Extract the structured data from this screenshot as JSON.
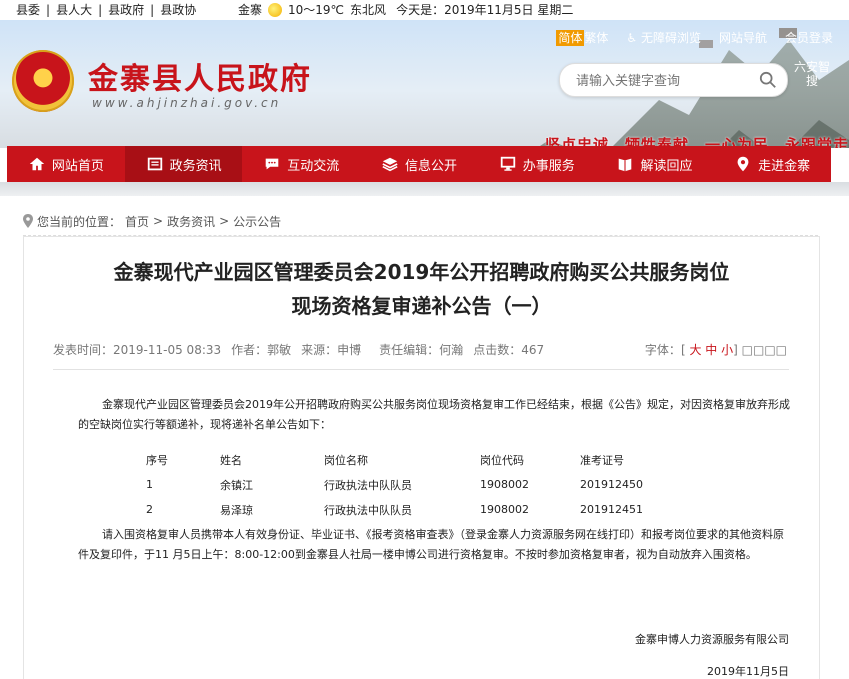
{
  "topbar": {
    "nav": [
      "县委",
      "县人大",
      "县政府",
      "县政协"
    ],
    "weather": {
      "city": "金寨",
      "temp": "10～19℃",
      "wind": "东北风"
    },
    "today": "今天是：2019年11月5日 星期二"
  },
  "header": {
    "site_name": "金寨县人民政府",
    "site_url": "www.ahjinzhai.gov.cn",
    "lang_simplified": "简体",
    "lang_traditional": "繁体",
    "accessible": "无障碍浏览",
    "site_nav": "网站导航",
    "login": "会员登录",
    "search_placeholder": "请输入关键字查询",
    "brand_right": "六安智搜",
    "slogan": "坚贞忠诚　牺牲奉献　一心为民　永跟党走",
    "colors": {
      "accent": "#c8141b",
      "accent_dark": "#a80f15",
      "highlight": "#f19a00"
    }
  },
  "navbar": [
    {
      "label": "网站首页",
      "icon": "home-icon"
    },
    {
      "label": "政务资讯",
      "icon": "newspaper-icon"
    },
    {
      "label": "互动交流",
      "icon": "chat-icon"
    },
    {
      "label": "信息公开",
      "icon": "layers-icon"
    },
    {
      "label": "办事服务",
      "icon": "monitor-icon"
    },
    {
      "label": "解读回应",
      "icon": "book-icon"
    },
    {
      "label": "走进金寨",
      "icon": "location-icon"
    }
  ],
  "breadcrumb": {
    "prefix": "您当前的位置：",
    "items": [
      "首页",
      "政务资讯",
      "公示公告"
    ],
    "sep": " > "
  },
  "article": {
    "title_line1": "金寨现代产业园区管理委员会2019年公开招聘政府购买公共服务岗位",
    "title_line2": "现场资格复审递补公告（一）",
    "meta": {
      "published": "发表时间：2019-11-05 08:33",
      "author": "作者：郭敏",
      "source": "来源：申博",
      "editor": "责任编辑：何瀚",
      "clicks": "点击数：467"
    },
    "font_label": "字体：",
    "font_sizes": [
      "大",
      "中",
      "小"
    ],
    "font_boxes": "□□□□",
    "para1": "金寨现代产业园区管理委员会2019年公开招聘政府购买公共服务岗位现场资格复审工作已经结束，根据《公告》规定，对因资格复审放弃形成的空缺岗位实行等额递补，现将递补名单公告如下：",
    "table": {
      "headers": [
        "序号",
        "姓名",
        "岗位名称",
        "岗位代码",
        "准考证号"
      ],
      "rows": [
        [
          "1",
          "余镇江",
          "行政执法中队队员",
          "1908002",
          "201912450"
        ],
        [
          "2",
          "易泽琼",
          "行政执法中队队员",
          "1908002",
          "201912451"
        ]
      ]
    },
    "para2": "请入围资格复审人员携带本人有效身份证、毕业证书、《报考资格审查表》（登录金寨人力资源服务网在线打印）和报考岗位要求的其他资料原件及复印件，于11 月5日上午：8:00-12:00到金寨县人社局一楼申博公司进行资格复审。不按时参加资格复审者，视为自动放弃入围资格。",
    "signature": "金寨申博人力资源服务有限公司",
    "date": "2019年11月5日"
  }
}
